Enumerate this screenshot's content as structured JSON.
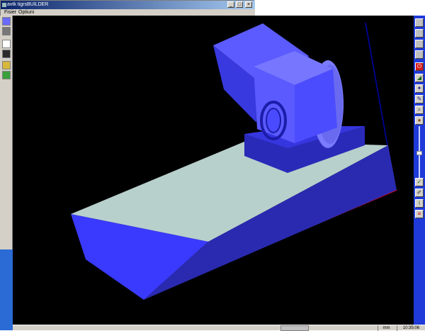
{
  "window": {
    "title": "avtk tigrsBUILDER",
    "menu": [
      "Fisier",
      "Optiuni"
    ]
  },
  "titlebar_buttons": {
    "minimize": "_",
    "maximize": "□",
    "close": "×"
  },
  "left_toolbar": {
    "tools": [
      "cube-icon",
      "shaded-cube-icon",
      "new-file-icon",
      "save-icon",
      "open-folder-icon",
      "exit-icon"
    ]
  },
  "right_toolbar": {
    "top_buttons": [
      "view-button-1",
      "view-button-2",
      "view-button-3",
      "view-button-4"
    ],
    "tools": [
      "power-icon",
      "chart-icon",
      "pin-icon",
      "pen-icon",
      "zoom-icon",
      "sphere-icon"
    ],
    "bottom_tools": [
      "check-icon",
      "edit-icon",
      "info-icon",
      "stack-icon"
    ]
  },
  "status": {
    "units": "mm",
    "time": "10:35:06"
  },
  "colors": {
    "background": "#000000",
    "part_blue": "#2f2fe0",
    "part_light": "#b8d0cc",
    "desktop": "#2a6bd6",
    "toolbar": "#1f3ad8"
  }
}
